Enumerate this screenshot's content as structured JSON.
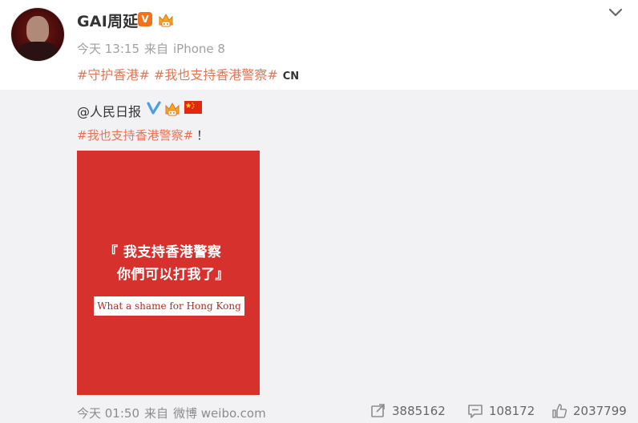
{
  "post": {
    "username": "GAI周延",
    "verified_badge": "V",
    "time": "今天 13:15",
    "source_prefix": "来自",
    "source": "iPhone 8",
    "topics": [
      "#守护香港#",
      "#我也支持香港警察#"
    ],
    "region_tag": "CN"
  },
  "repost": {
    "author": "@人民日报",
    "topic": "#我也支持香港警察#",
    "exclamation": "！",
    "image": {
      "line1": "『 我支持香港警察",
      "line2": "你們可以打我了』",
      "banner": "What a shame for Hong Kong"
    },
    "time": "今天 01:50",
    "source_prefix": "来自",
    "source": "微博 weibo.com",
    "stats": {
      "forwards": "3885162",
      "comments": "108172",
      "likes": "2037799"
    }
  },
  "colors": {
    "link": "#eb7350",
    "panel_bg": "#f2f2f5",
    "card_red": "#d7312e",
    "v_orange": "#f0731b",
    "v_blue": "#4a9de3"
  },
  "icons": [
    "chevron-down-icon",
    "verified-v-icon",
    "member-crown-icon",
    "china-flag-icon",
    "forward-icon",
    "comment-icon",
    "like-icon"
  ]
}
